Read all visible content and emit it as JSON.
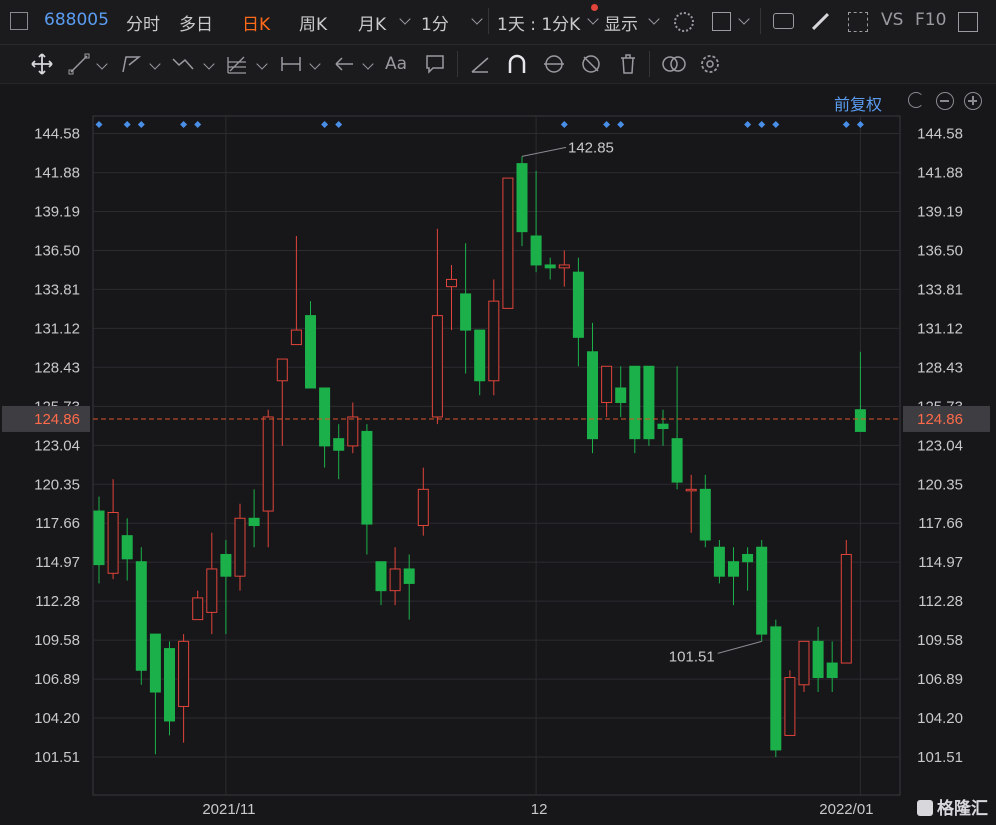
{
  "topbar": {
    "stock_code": "688005",
    "tabs": [
      "分时",
      "多日",
      "日K",
      "周K",
      "月K"
    ],
    "active_tab": "日K",
    "period": "1分",
    "range": "1天 : 1分K",
    "display_label": "显示",
    "vs_label": "VS",
    "f10_label": "F10"
  },
  "chart_header": {
    "adjust_label": "前复权"
  },
  "brand": {
    "name": "格隆汇"
  },
  "colors": {
    "up": "#e0443a",
    "down": "#1cb04a",
    "grid": "#2c2c30",
    "axis_text": "#c9c9cc",
    "current_price_line": "#d8562a",
    "marker": "#4a8fe7"
  },
  "chart_data": {
    "type": "candlestick",
    "title": "",
    "y_ticks": [
      144.58,
      141.88,
      139.19,
      136.5,
      133.81,
      131.12,
      128.43,
      125.73,
      123.04,
      120.35,
      117.66,
      114.97,
      112.28,
      109.58,
      106.89,
      104.2,
      101.51
    ],
    "ylim": [
      101.51,
      144.58
    ],
    "x_ticks": [
      "2021/11",
      "12",
      "2022/01"
    ],
    "x_tick_candle_index": [
      9,
      31,
      54
    ],
    "current_price": 124.86,
    "max_label": "142.85",
    "max_candle_index": 30,
    "min_label": "101.51",
    "min_candle_index": 47,
    "marker_candle_index": [
      0,
      2,
      3,
      6,
      7,
      16,
      17,
      33,
      36,
      37,
      46,
      47,
      48,
      53,
      54
    ],
    "candles": [
      {
        "o": 118.5,
        "h": 119.5,
        "c": 114.8,
        "l": 113.5
      },
      {
        "o": 114.2,
        "h": 120.7,
        "c": 118.4,
        "l": 113.8
      },
      {
        "o": 116.8,
        "h": 118.0,
        "c": 115.2,
        "l": 113.7
      },
      {
        "o": 115.0,
        "h": 116.0,
        "c": 107.5,
        "l": 106.5
      },
      {
        "o": 110.0,
        "h": 110.0,
        "c": 106.0,
        "l": 101.7
      },
      {
        "o": 109.0,
        "h": 109.5,
        "c": 104.0,
        "l": 103.0
      },
      {
        "o": 105.0,
        "h": 110.0,
        "c": 109.5,
        "l": 102.5
      },
      {
        "o": 111.0,
        "h": 113.0,
        "c": 112.5,
        "l": 111.0
      },
      {
        "o": 111.5,
        "h": 117.0,
        "c": 114.5,
        "l": 110.0
      },
      {
        "o": 115.5,
        "h": 116.5,
        "c": 114.0,
        "l": 110.0
      },
      {
        "o": 114.0,
        "h": 119.0,
        "c": 118.0,
        "l": 113.0
      },
      {
        "o": 118.0,
        "h": 120.0,
        "c": 117.5,
        "l": 116.0
      },
      {
        "o": 118.5,
        "h": 125.5,
        "c": 125.0,
        "l": 116.0
      },
      {
        "o": 127.5,
        "h": 128.5,
        "c": 129.0,
        "l": 123.0
      },
      {
        "o": 130.0,
        "h": 137.5,
        "c": 131.0,
        "l": 130.0
      },
      {
        "o": 132.0,
        "h": 133.0,
        "c": 127.0,
        "l": 127.0
      },
      {
        "o": 127.0,
        "h": 127.0,
        "c": 123.0,
        "l": 121.5
      },
      {
        "o": 123.5,
        "h": 124.5,
        "c": 122.7,
        "l": 120.7
      },
      {
        "o": 123.0,
        "h": 126.0,
        "c": 125.0,
        "l": 122.5
      },
      {
        "o": 124.0,
        "h": 124.5,
        "c": 117.6,
        "l": 115.5
      },
      {
        "o": 115.0,
        "h": 115.0,
        "c": 113.0,
        "l": 112.0
      },
      {
        "o": 113.0,
        "h": 116.0,
        "c": 114.5,
        "l": 112.0
      },
      {
        "o": 114.5,
        "h": 115.5,
        "c": 113.5,
        "l": 111.0
      },
      {
        "o": 117.5,
        "h": 121.5,
        "c": 120.0,
        "l": 116.8
      },
      {
        "o": 125.0,
        "h": 138.0,
        "c": 132.0,
        "l": 124.5
      },
      {
        "o": 134.0,
        "h": 135.5,
        "c": 134.5,
        "l": 131.0
      },
      {
        "o": 133.5,
        "h": 137.0,
        "c": 131.0,
        "l": 128.0
      },
      {
        "o": 131.0,
        "h": 131.0,
        "c": 127.5,
        "l": 126.5
      },
      {
        "o": 127.5,
        "h": 134.5,
        "c": 133.0,
        "l": 126.5
      },
      {
        "o": 132.5,
        "h": 140.0,
        "c": 141.5,
        "l": 132.5
      },
      {
        "o": 142.5,
        "h": 143.0,
        "c": 137.8,
        "l": 136.8
      },
      {
        "o": 137.5,
        "h": 142.0,
        "c": 135.5,
        "l": 135.0
      },
      {
        "o": 135.5,
        "h": 136.0,
        "c": 135.3,
        "l": 134.5
      },
      {
        "o": 135.3,
        "h": 136.5,
        "c": 135.5,
        "l": 134.0
      },
      {
        "o": 135.0,
        "h": 136.0,
        "c": 130.5,
        "l": 128.5
      },
      {
        "o": 129.5,
        "h": 131.5,
        "c": 123.5,
        "l": 122.5
      },
      {
        "o": 126.0,
        "h": 128.5,
        "c": 128.5,
        "l": 125.0
      },
      {
        "o": 127.0,
        "h": 128.5,
        "c": 126.0,
        "l": 125.0
      },
      {
        "o": 128.5,
        "h": 128.5,
        "c": 123.5,
        "l": 122.5
      },
      {
        "o": 128.5,
        "h": 128.5,
        "c": 123.5,
        "l": 123.0
      },
      {
        "o": 124.5,
        "h": 125.5,
        "c": 124.2,
        "l": 123.0
      },
      {
        "o": 123.5,
        "h": 128.5,
        "c": 120.5,
        "l": 120.0
      },
      {
        "o": 120.0,
        "h": 121.0,
        "c": 120.0,
        "l": 117.0
      },
      {
        "o": 120.0,
        "h": 121.0,
        "c": 116.5,
        "l": 116.0
      },
      {
        "o": 116.0,
        "h": 116.5,
        "c": 114.0,
        "l": 113.5
      },
      {
        "o": 115.0,
        "h": 116.0,
        "c": 114.0,
        "l": 112.0
      },
      {
        "o": 115.5,
        "h": 116.0,
        "c": 115.0,
        "l": 113.0
      },
      {
        "o": 116.0,
        "h": 116.5,
        "c": 110.0,
        "l": 109.5
      },
      {
        "o": 110.5,
        "h": 111.0,
        "c": 102.0,
        "l": 101.5
      },
      {
        "o": 103.0,
        "h": 107.5,
        "c": 107.0,
        "l": 103.0
      },
      {
        "o": 106.5,
        "h": 109.0,
        "c": 109.5,
        "l": 106.0
      },
      {
        "o": 109.5,
        "h": 110.5,
        "c": 107.0,
        "l": 106.0
      },
      {
        "o": 108.0,
        "h": 109.5,
        "c": 107.0,
        "l": 106.0
      },
      {
        "o": 108.0,
        "h": 116.5,
        "c": 115.5,
        "l": 108.0
      },
      {
        "o": 125.5,
        "h": 129.5,
        "c": 124.0,
        "l": 124.0
      }
    ]
  }
}
